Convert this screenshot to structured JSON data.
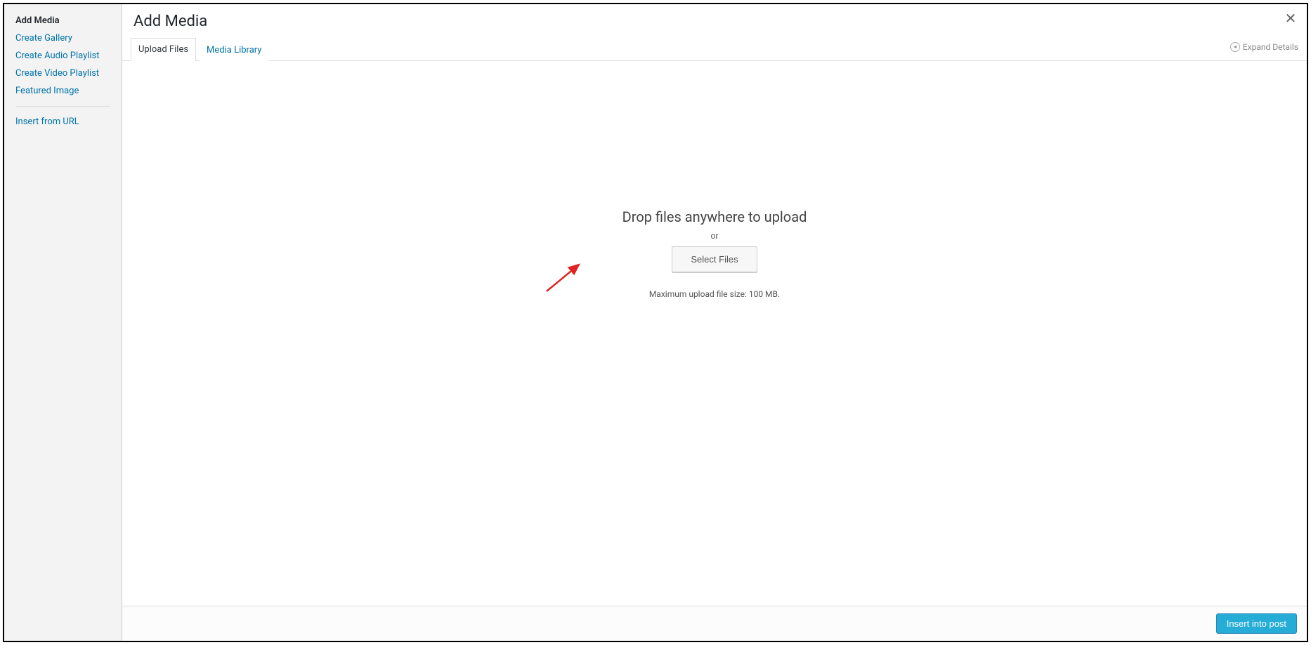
{
  "sidebar": {
    "heading": "Add Media",
    "items": [
      {
        "label": "Create Gallery"
      },
      {
        "label": "Create Audio Playlist"
      },
      {
        "label": "Create Video Playlist"
      },
      {
        "label": "Featured Image"
      }
    ],
    "below_items": [
      {
        "label": "Insert from URL"
      }
    ]
  },
  "header": {
    "title": "Add Media"
  },
  "tabs": {
    "upload": "Upload Files",
    "library": "Media Library"
  },
  "expand_details": "Expand Details",
  "upload_area": {
    "drop_text": "Drop files anywhere to upload",
    "or_text": "or",
    "select_button": "Select Files",
    "max_size": "Maximum upload file size: 100 MB."
  },
  "footer": {
    "insert_button": "Insert into post"
  }
}
